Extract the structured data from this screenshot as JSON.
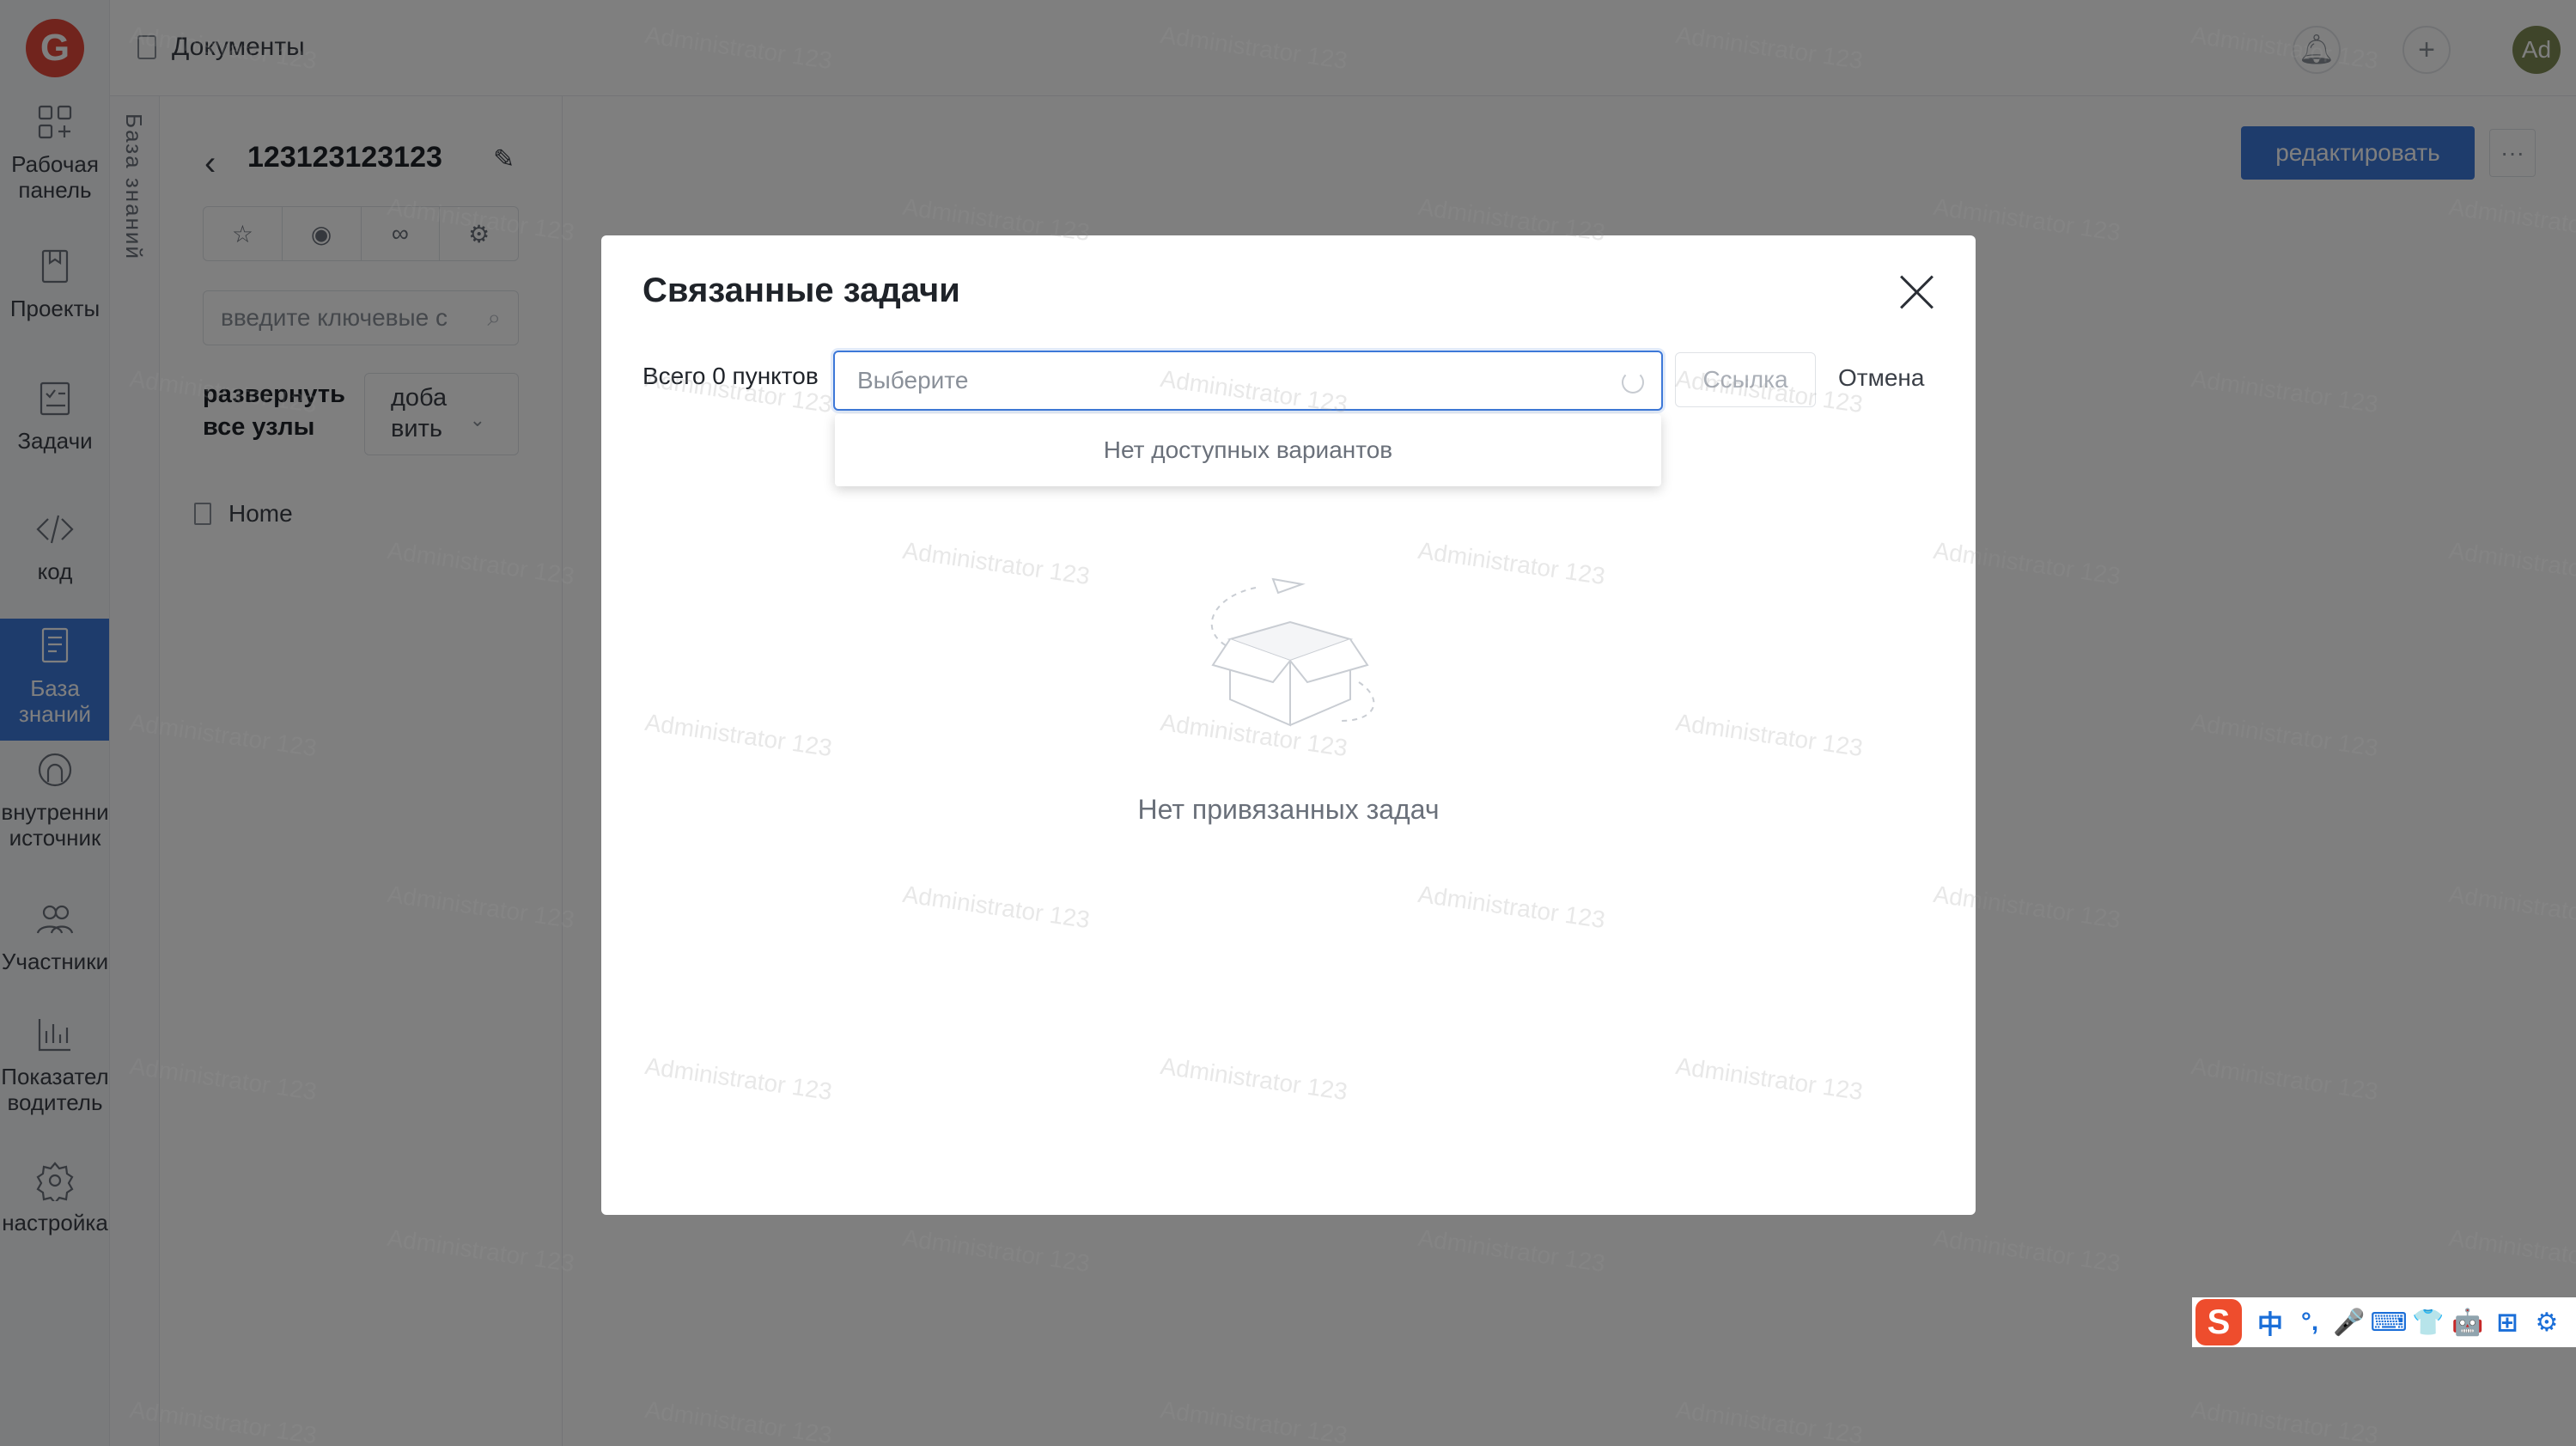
{
  "sidebar": {
    "logo_letter": "G",
    "items": [
      {
        "label_lines": [
          "Рабочая",
          "панель"
        ],
        "icon": "dashboard-icon"
      },
      {
        "label_lines": [
          "Проекты"
        ],
        "icon": "projects-icon"
      },
      {
        "label_lines": [
          "Задачи"
        ],
        "icon": "tasks-icon"
      },
      {
        "label_lines": [
          "код"
        ],
        "icon": "code-icon"
      },
      {
        "label_lines": [
          "База",
          "знаний"
        ],
        "icon": "knowledge-base-icon"
      },
      {
        "label_lines": [
          "внутренни",
          "источник"
        ],
        "icon": "inner-source-icon"
      },
      {
        "label_lines": [
          "Участники"
        ],
        "icon": "members-icon"
      },
      {
        "label_lines": [
          "Показател",
          "водитель"
        ],
        "icon": "metrics-icon"
      },
      {
        "label_lines": [
          "настройка"
        ],
        "icon": "settings-icon"
      }
    ],
    "active_index": 4
  },
  "vertical_tab": "База знаний",
  "header": {
    "breadcrumb": "Документы",
    "avatar_text": "Ad"
  },
  "tree_panel": {
    "doc_title": "123123123123",
    "search_placeholder": "введите ключевые с",
    "expand_all": "развернуть все узлы",
    "add_label": "доба вить",
    "home_item": "Home"
  },
  "main": {
    "edit_button": "редактировать",
    "more_button": "···"
  },
  "modal": {
    "title": "Связанные задачи",
    "total_label": "Всего 0 пунктов",
    "select_placeholder": "Выберите",
    "link_button": "Ссылка",
    "cancel_button": "Отмена",
    "dropdown_empty": "Нет доступных вариантов",
    "empty_text": "Нет привязанных задач"
  },
  "ime": {
    "logo": "S",
    "items": [
      "中",
      "°,",
      "🎤",
      "⌨",
      "👕",
      "🤖",
      "⊞",
      "⚙"
    ]
  },
  "watermark_text": "Administrator 123",
  "colors": {
    "accent": "#3d78d8",
    "logo_red": "#e3483a",
    "overlay": "rgba(0,0,0,0.5)"
  }
}
